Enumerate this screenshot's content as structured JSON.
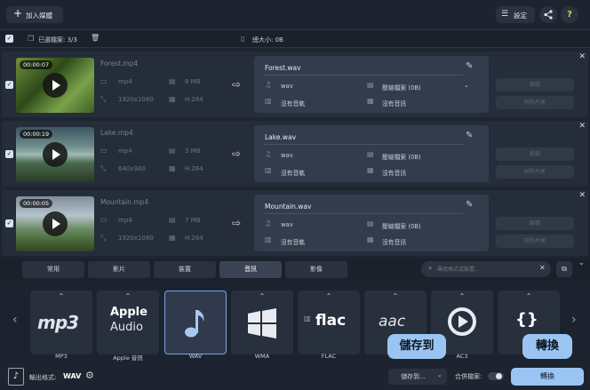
{
  "header": {
    "add_media": "加入媒體",
    "settings": "設定",
    "help": "?"
  },
  "toolbar": {
    "selected": "已選檔案: 3/3",
    "total_size": "總大小: 0B"
  },
  "files": [
    {
      "name": "Forest.mp4",
      "duration": "00:00:07",
      "format": "mp4",
      "size": "8 MB",
      "resolution": "1920x1080",
      "codec": "H.264",
      "out_name": "Forest.wav",
      "audio": "wav",
      "size_opt": "壓縮檔案 (0B)",
      "subtitle": "沒有音軌",
      "audio_track": "沒有音訊",
      "btn1": "編輯",
      "btn2": "刪除片尾"
    },
    {
      "name": "Lake.mp4",
      "duration": "00:00:19",
      "format": "mp4",
      "size": "3 MB",
      "resolution": "640x360",
      "codec": "H.264",
      "out_name": "Lake.wav",
      "audio": "wav",
      "size_opt": "壓縮檔案 (0B)",
      "subtitle": "沒有音軌",
      "audio_track": "沒有音訊",
      "btn1": "編輯",
      "btn2": "刪除片尾"
    },
    {
      "name": "Mountain.mp4",
      "duration": "00:00:05",
      "format": "mp4",
      "size": "7 MB",
      "resolution": "1920x1080",
      "codec": "H.264",
      "out_name": "Mountain.wav",
      "audio": "wav",
      "size_opt": "壓縮檔案 (0B)",
      "subtitle": "沒有音軌",
      "audio_track": "沒有音訊",
      "btn1": "編輯",
      "btn2": "刪除片尾"
    }
  ],
  "tabs": [
    "常用",
    "影片",
    "裝置",
    "音訊",
    "影像"
  ],
  "search": {
    "placeholder": "尋找格式或裝置..."
  },
  "formats": [
    {
      "label": "MP3",
      "logo": "mp3"
    },
    {
      "label": "Apple 音訊",
      "logo_top": "Apple",
      "logo_bottom": "Audio"
    },
    {
      "label": "WAV"
    },
    {
      "label": "WMA"
    },
    {
      "label": "FLAC",
      "logo": "flac"
    },
    {
      "label": "AAC",
      "logo": "aac"
    },
    {
      "label": "AC3"
    },
    {
      "label": "M"
    }
  ],
  "bottom": {
    "output_label": "輸出格式:",
    "output_value": "WAV",
    "save_to": "儲存到...",
    "merge": "合併檔案:",
    "convert": "轉換"
  },
  "tooltips": {
    "save": "儲存到",
    "convert": "轉換"
  },
  "colors": {
    "accent": "#9ac5f2",
    "selected_border": "#7ba4e6"
  }
}
